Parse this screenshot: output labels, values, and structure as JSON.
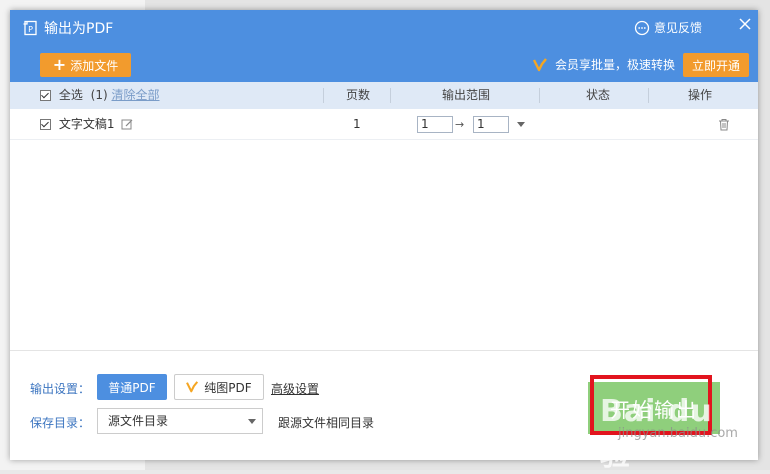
{
  "dialog": {
    "title": "输出为PDF",
    "feedback_label": "意见反馈"
  },
  "toolbar": {
    "add_file_label": "添加文件",
    "vip_promo": "会员享批量，极速转换",
    "open_vip_label": "立即开通"
  },
  "table": {
    "select_all_label": "全选",
    "selected_count": "(1)",
    "clear_all_label": "清除全部",
    "columns": {
      "pages": "页数",
      "range": "输出范围",
      "status": "状态",
      "action": "操作"
    },
    "rows": [
      {
        "name": "文字文稿1",
        "pages": "1",
        "range_from": "1",
        "range_to": "1",
        "status": ""
      }
    ]
  },
  "settings": {
    "output_label": "输出设置：",
    "normal_pdf_label": "普通PDF",
    "image_pdf_label": "纯图PDF",
    "advanced_label": "高级设置",
    "save_dir_label": "保存目录：",
    "save_dir_value": "源文件目录",
    "follow_source_label": "跟源文件相同目录",
    "start_label": "开始输出"
  },
  "watermark": {
    "logo_text": "Bai du 经验",
    "url_text": "jingyan.baidu.com"
  },
  "colors": {
    "titlebar": "#4d8fe0",
    "accent_orange": "#f29b2d",
    "start_green": "#8fcf7c",
    "highlight_red": "#e2141e"
  }
}
